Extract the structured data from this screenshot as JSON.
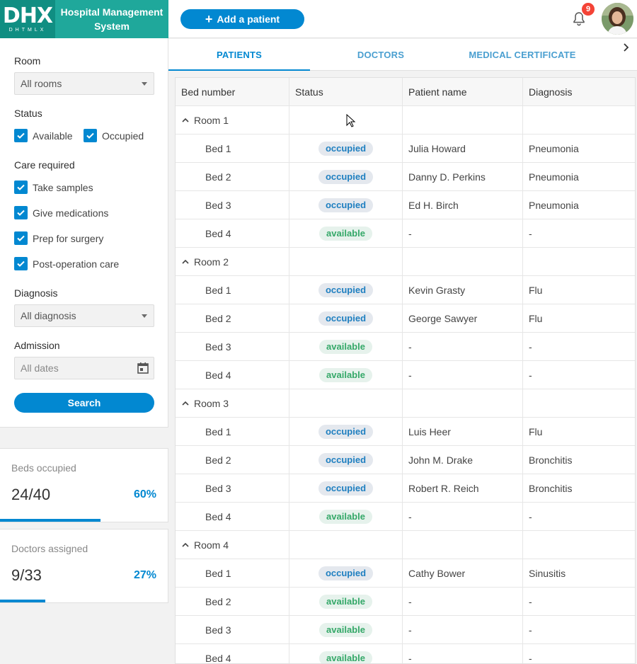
{
  "header": {
    "logo_text": "DHX",
    "logo_subtext": "DHTMLX",
    "app_title": "Hospital Management System",
    "add_button_label": "Add a patient",
    "notification_count": "9"
  },
  "filters": {
    "room_label": "Room",
    "room_value": "All rooms",
    "status_label": "Status",
    "status_options": [
      "Available",
      "Occupied"
    ],
    "care_label": "Care required",
    "care_options": [
      "Take samples",
      "Give medications",
      "Prep for surgery",
      "Post-operation care"
    ],
    "diagnosis_label": "Diagnosis",
    "diagnosis_value": "All diagnosis",
    "admission_label": "Admission",
    "admission_placeholder": "All dates",
    "search_label": "Search"
  },
  "stats": [
    {
      "title": "Beds occupied",
      "value": "24/40",
      "percent_label": "60%",
      "fraction": 0.6
    },
    {
      "title": "Doctors assigned",
      "value": "9/33",
      "percent_label": "27%",
      "fraction": 0.27
    }
  ],
  "tabs": [
    "PATIENTS",
    "DOCTORS",
    "MEDICAL CERTIFICATE"
  ],
  "active_tab": 0,
  "grid": {
    "columns": [
      "Bed number",
      "Status",
      "Patient name",
      "Diagnosis"
    ],
    "rooms": [
      {
        "name": "Room 1",
        "beds": [
          {
            "bed": "Bed 1",
            "status": "occupied",
            "patient": "Julia Howard",
            "diagnosis": "Pneumonia"
          },
          {
            "bed": "Bed 2",
            "status": "occupied",
            "patient": "Danny D. Perkins",
            "diagnosis": "Pneumonia"
          },
          {
            "bed": "Bed 3",
            "status": "occupied",
            "patient": "Ed H. Birch",
            "diagnosis": "Pneumonia"
          },
          {
            "bed": "Bed 4",
            "status": "available",
            "patient": "-",
            "diagnosis": "-"
          }
        ]
      },
      {
        "name": "Room 2",
        "beds": [
          {
            "bed": "Bed 1",
            "status": "occupied",
            "patient": "Kevin Grasty",
            "diagnosis": "Flu"
          },
          {
            "bed": "Bed 2",
            "status": "occupied",
            "patient": "George Sawyer",
            "diagnosis": "Flu"
          },
          {
            "bed": "Bed 3",
            "status": "available",
            "patient": "-",
            "diagnosis": "-"
          },
          {
            "bed": "Bed 4",
            "status": "available",
            "patient": "-",
            "diagnosis": "-"
          }
        ]
      },
      {
        "name": "Room 3",
        "beds": [
          {
            "bed": "Bed 1",
            "status": "occupied",
            "patient": "Luis Heer",
            "diagnosis": "Flu"
          },
          {
            "bed": "Bed 2",
            "status": "occupied",
            "patient": "John M. Drake",
            "diagnosis": "Bronchitis"
          },
          {
            "bed": "Bed 3",
            "status": "occupied",
            "patient": "Robert R. Reich",
            "diagnosis": "Bronchitis"
          },
          {
            "bed": "Bed 4",
            "status": "available",
            "patient": "-",
            "diagnosis": "-"
          }
        ]
      },
      {
        "name": "Room 4",
        "beds": [
          {
            "bed": "Bed 1",
            "status": "occupied",
            "patient": "Cathy Bower",
            "diagnosis": "Sinusitis"
          },
          {
            "bed": "Bed 2",
            "status": "available",
            "patient": "-",
            "diagnosis": "-"
          },
          {
            "bed": "Bed 3",
            "status": "available",
            "patient": "-",
            "diagnosis": "-"
          },
          {
            "bed": "Bed 4",
            "status": "available",
            "patient": "-",
            "diagnosis": "-"
          }
        ]
      }
    ]
  },
  "colors": {
    "primary": "#0288d1",
    "brand": "#1fa89b",
    "occupied": "#1e7fc0",
    "available": "#34a868",
    "badge": "#f44336"
  }
}
